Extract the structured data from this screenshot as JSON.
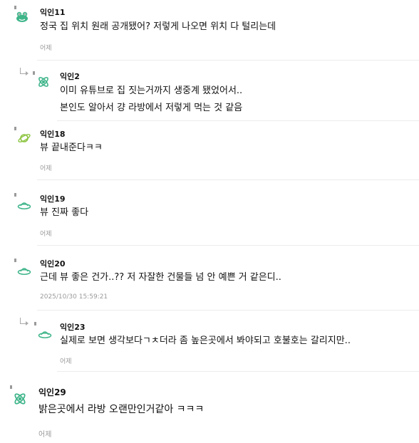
{
  "comments": [
    {
      "nickname": "익인11",
      "lines": [
        "정국 집 위치 원래 공개됐어? 저렇게 나오면 위치 다 털리는데"
      ],
      "time": "어제"
    },
    {
      "nickname": "익인2",
      "lines": [
        "이미 유튜브로 집 짓는거까지 생중계 됐었어서..",
        "본인도 알아서 걍 라방에서 저렇게 먹는 것 같음"
      ]
    },
    {
      "nickname": "익인18",
      "lines": [
        "뷰 끝내준다ㅋㅋ"
      ],
      "time": "어제"
    },
    {
      "nickname": "익인19",
      "lines": [
        "뷰 진짜 좋다"
      ],
      "time": "어제"
    },
    {
      "nickname": "익인20",
      "lines": [
        "근데 뷰 좋은 건가..?? 저 자잘한 건물들 넘 안 예쁜 거 같은디.."
      ],
      "time": "2025/10/30 15:59:21"
    },
    {
      "nickname": "익인23",
      "lines": [
        "실제로 보면 생각보다ㄱㅊ더라 좀 높은곳에서 봐야되고 호불호는 갈리지만.."
      ],
      "time": "어제"
    },
    {
      "nickname": "익인29",
      "lines": [
        "밝은곳에서 라방 오랜만인거같아 ㅋㅋㅋ"
      ],
      "time": "어제"
    }
  ],
  "colors": {
    "avatar": "#3fb58a",
    "avatar_dark": "#2a9a70",
    "meta": "#9a9a9a",
    "divider": "#ececec"
  }
}
